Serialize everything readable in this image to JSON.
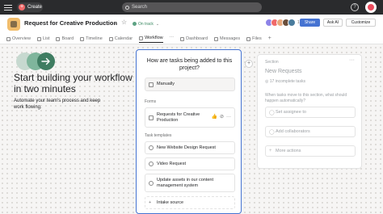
{
  "topbar": {
    "create_label": "Create",
    "search_placeholder": "Search",
    "help_icon": "?"
  },
  "header": {
    "title": "Request for Creative Production",
    "status": "On track",
    "member_count": "10",
    "share_label": "Share",
    "ask_ai_label": "Ask AI",
    "customize_label": "Customize",
    "member_colors": [
      "#8d84e8",
      "#f06a6a",
      "#e8a87c",
      "#6b4f3b",
      "#4a7c9d"
    ]
  },
  "tabs": [
    {
      "label": "Overview",
      "active": false
    },
    {
      "label": "List",
      "active": false
    },
    {
      "label": "Board",
      "active": false
    },
    {
      "label": "Timeline",
      "active": false
    },
    {
      "label": "Calendar",
      "active": false
    },
    {
      "label": "Workflow",
      "active": true
    },
    {
      "label": "Dashboard",
      "active": false
    },
    {
      "label": "Messages",
      "active": false
    },
    {
      "label": "Files",
      "active": false
    }
  ],
  "hero": {
    "title": "Start building your workflow in two minutes",
    "subtitle": "Automate your team's process and keep work flowing.",
    "circle_colors": [
      "#c7d9d0",
      "#7fb59c",
      "#3f7d62"
    ]
  },
  "card": {
    "question": "How are tasks being added to this project?",
    "manual_label": "Manually",
    "forms_label": "Forms",
    "form_name": "Requests for Creative Production",
    "templates_label": "Task templates",
    "templates": [
      "New Website Design Request",
      "Video Request",
      "Update assets in our content management system"
    ],
    "intake_label": "Intake source"
  },
  "panel": {
    "section_label": "Section",
    "section_name": "New Requests",
    "incomplete": "17 incomplete tasks",
    "question": "When tasks move to this section, what should happen automatically?",
    "assignee_label": "Set assignee to",
    "collaborators_label": "Add collaborators",
    "more_actions_label": "More actions"
  },
  "colors": {
    "accent": "#4573d2",
    "topbar": "#2a2b2d",
    "create_plus": "#f06a6a",
    "status_green": "#5da283",
    "project_icon": "#f1bd6c"
  }
}
